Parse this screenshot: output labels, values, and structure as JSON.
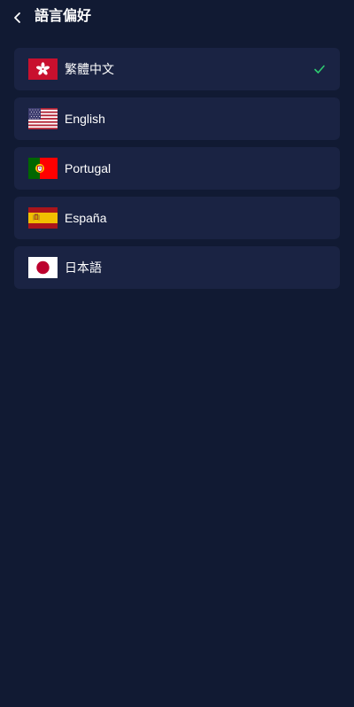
{
  "header": {
    "title": "語言偏好",
    "back_icon": "chevron-left-icon"
  },
  "colors": {
    "background": "#111a33",
    "item_background": "#1a2343",
    "check": "#2ecc71",
    "text": "#ffffff"
  },
  "languages": [
    {
      "label": "繁體中文",
      "flag": "hong-kong-flag-icon",
      "selected": true
    },
    {
      "label": "English",
      "flag": "usa-flag-icon",
      "selected": false
    },
    {
      "label": "Portugal",
      "flag": "portugal-flag-icon",
      "selected": false
    },
    {
      "label": "España",
      "flag": "spain-flag-icon",
      "selected": false
    },
    {
      "label": "日本語",
      "flag": "japan-flag-icon",
      "selected": false
    }
  ]
}
